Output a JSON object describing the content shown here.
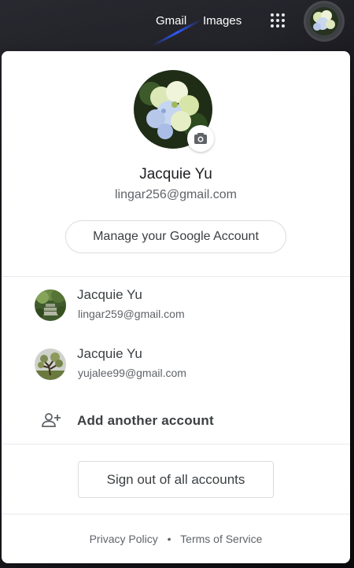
{
  "topbar": {
    "gmail_label": "Gmail",
    "images_label": "Images",
    "apps_icon": "apps-grid-icon"
  },
  "account": {
    "name": "Jacquie Yu",
    "email": "lingar256@gmail.com",
    "manage_label": "Manage your Google Account",
    "camera_icon": "camera-icon"
  },
  "other_accounts": [
    {
      "name": "Jacquie Yu",
      "email": "lingar259@gmail.com"
    },
    {
      "name": "Jacquie Yu",
      "email": "yujalee99@gmail.com"
    }
  ],
  "add_account": {
    "label": "Add another account",
    "icon": "person-add-icon"
  },
  "signout_label": "Sign out of all accounts",
  "footer": {
    "privacy": "Privacy Policy",
    "separator": "•",
    "terms": "Terms of Service"
  },
  "colors": {
    "text_primary": "#202124",
    "text_secondary": "#5f6368",
    "border": "#dadce0"
  }
}
